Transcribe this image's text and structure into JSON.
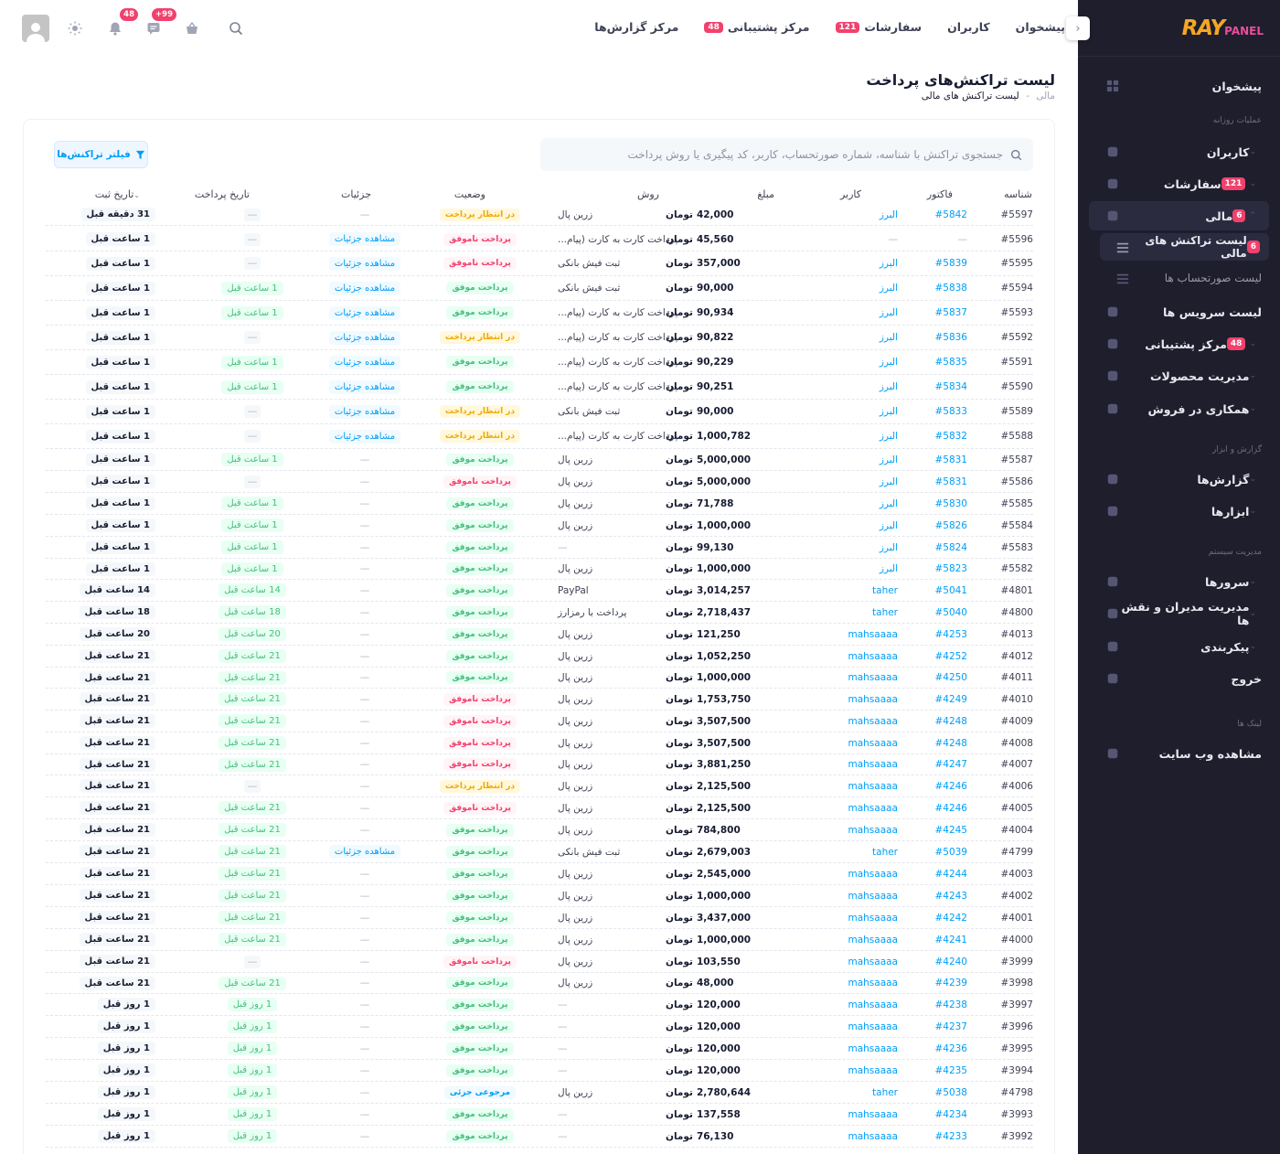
{
  "sidebar": {
    "brand_main": "RAY",
    "brand_sub": "PANEL",
    "items": [
      {
        "label": "پیشخوان",
        "icon": "dashboard-icon"
      },
      {
        "label": "کاربران",
        "icon": "users-icon"
      },
      {
        "label": "سفارشات",
        "icon": "cart-icon",
        "badge": "121"
      },
      {
        "label": "مالی",
        "icon": "wallet-icon",
        "badge": "6"
      },
      {
        "label": "لیست سرویس ها",
        "icon": "grid-icon"
      },
      {
        "label": "مرکز پشتیبانی",
        "icon": "support-icon",
        "badge": "48"
      },
      {
        "label": "مدیریت محصولات",
        "icon": "lock-icon"
      },
      {
        "label": "همکاری در فروش",
        "icon": "affiliate-icon"
      },
      {
        "label": "گزارش‌ها",
        "icon": "report-icon"
      },
      {
        "label": "ابزارها",
        "icon": "tools-icon"
      },
      {
        "label": "سرورها",
        "icon": "server-icon"
      },
      {
        "label": "مدیریت مدیران و نقش ها",
        "icon": "admins-icon"
      },
      {
        "label": "پیکربندی",
        "icon": "config-icon"
      },
      {
        "label": "خروج",
        "icon": "logout-icon"
      },
      {
        "label": "مشاهده وب سایت",
        "icon": "external-link-icon"
      }
    ],
    "sub_items": [
      {
        "label": "لیست تراکنش های مالی",
        "badge": "6"
      },
      {
        "label": "لیست صورتحساب ها"
      }
    ],
    "sections": [
      "عملیات روزانه",
      "گزارش و ابزار",
      "مدیریت سیستم",
      "لینک ها"
    ]
  },
  "header": {
    "nav": [
      {
        "label": "پیشخوان"
      },
      {
        "label": "کاربران"
      },
      {
        "label": "سفارشات",
        "badge": "121"
      },
      {
        "label": "مرکز پشتیبانی",
        "badge": "48"
      },
      {
        "label": "مرکز گزارش‌ها"
      }
    ],
    "cart_badge": "+99",
    "messages_badge": "48"
  },
  "page": {
    "title": "لیست تراکنش‌های پرداخت",
    "breadcrumb_parent": "مالی",
    "breadcrumb_sep": "-",
    "breadcrumb_current": "لیست تراکنش های مالی",
    "search_placeholder": "جستجوی تراکنش با شناسه، شماره صورتحساب، کاربر، کد پیگیری یا روش پرداخت",
    "filter_label": "فیلتر تراکنش‌ها"
  },
  "table": {
    "headers": {
      "id": "شناسه",
      "invoice": "فاکتور",
      "user": "کاربر",
      "amount": "مبلغ",
      "method": "روش",
      "status": "وضعیت",
      "details": "جزئیات",
      "pay_date": "تاریخ پرداخت",
      "reg_date": "تاریخ ثبت"
    },
    "currency": "تومان",
    "status_labels": {
      "pending": "در انتظار پرداخت",
      "failed": "پرداخت ناموفق",
      "success": "پرداخت موفق",
      "partial": "مرجوعی جزئی"
    },
    "details_label": "مشاهده جزئیات",
    "empty": "—",
    "rows": [
      {
        "id": "#5597",
        "inv": "#5842",
        "user": "البرز",
        "amt": "42,000",
        "meth": "زرین پال",
        "st": "pending",
        "det": false,
        "pd": "",
        "rd": "31 دقیقه قبل"
      },
      {
        "id": "#5596",
        "inv": "",
        "user": "",
        "amt": "45,560",
        "meth": "پرداخت کارت به کارت (پیام...",
        "st": "failed",
        "det": true,
        "pd": "",
        "rd": "1 ساعت قبل"
      },
      {
        "id": "#5595",
        "inv": "#5839",
        "user": "البرز",
        "amt": "357,000",
        "meth": "ثبت فیش بانکی",
        "st": "failed",
        "det": true,
        "pd": "",
        "rd": "1 ساعت قبل"
      },
      {
        "id": "#5594",
        "inv": "#5838",
        "user": "البرز",
        "amt": "90,000",
        "meth": "ثبت فیش بانکی",
        "st": "success",
        "det": true,
        "pd": "1 ساعت قبل",
        "rd": "1 ساعت قبل"
      },
      {
        "id": "#5593",
        "inv": "#5837",
        "user": "البرز",
        "amt": "90,934",
        "meth": "پرداخت کارت به کارت (پیام...",
        "st": "success",
        "det": true,
        "pd": "1 ساعت قبل",
        "rd": "1 ساعت قبل"
      },
      {
        "id": "#5592",
        "inv": "#5836",
        "user": "البرز",
        "amt": "90,822",
        "meth": "پرداخت کارت به کارت (پیام...",
        "st": "pending",
        "det": true,
        "pd": "",
        "rd": "1 ساعت قبل"
      },
      {
        "id": "#5591",
        "inv": "#5835",
        "user": "البرز",
        "amt": "90,229",
        "meth": "پرداخت کارت به کارت (پیام...",
        "st": "success",
        "det": true,
        "pd": "1 ساعت قبل",
        "rd": "1 ساعت قبل"
      },
      {
        "id": "#5590",
        "inv": "#5834",
        "user": "البرز",
        "amt": "90,251",
        "meth": "پرداخت کارت به کارت (پیام...",
        "st": "success",
        "det": true,
        "pd": "1 ساعت قبل",
        "rd": "1 ساعت قبل"
      },
      {
        "id": "#5589",
        "inv": "#5833",
        "user": "البرز",
        "amt": "90,000",
        "meth": "ثبت فیش بانکی",
        "st": "pending",
        "det": true,
        "pd": "",
        "rd": "1 ساعت قبل"
      },
      {
        "id": "#5588",
        "inv": "#5832",
        "user": "البرز",
        "amt": "1,000,782",
        "meth": "پرداخت کارت به کارت (پیام...",
        "st": "pending",
        "det": true,
        "pd": "",
        "rd": "1 ساعت قبل"
      },
      {
        "id": "#5587",
        "inv": "#5831",
        "user": "البرز",
        "amt": "5,000,000",
        "meth": "زرین پال",
        "st": "success",
        "det": false,
        "pd": "1 ساعت قبل",
        "rd": "1 ساعت قبل"
      },
      {
        "id": "#5586",
        "inv": "#5831",
        "user": "البرز",
        "amt": "5,000,000",
        "meth": "زرین پال",
        "st": "failed",
        "det": false,
        "pd": "",
        "rd": "1 ساعت قبل"
      },
      {
        "id": "#5585",
        "inv": "#5830",
        "user": "البرز",
        "amt": "71,788",
        "meth": "زرین پال",
        "st": "success",
        "det": false,
        "pd": "1 ساعت قبل",
        "rd": "1 ساعت قبل"
      },
      {
        "id": "#5584",
        "inv": "#5826",
        "user": "البرز",
        "amt": "1,000,000",
        "meth": "زرین پال",
        "st": "success",
        "det": false,
        "pd": "1 ساعت قبل",
        "rd": "1 ساعت قبل"
      },
      {
        "id": "#5583",
        "inv": "#5824",
        "user": "البرز",
        "amt": "99,130",
        "meth": "",
        "st": "success",
        "det": false,
        "pd": "1 ساعت قبل",
        "rd": "1 ساعت قبل"
      },
      {
        "id": "#5582",
        "inv": "#5823",
        "user": "البرز",
        "amt": "1,000,000",
        "meth": "زرین پال",
        "st": "success",
        "det": false,
        "pd": "1 ساعت قبل",
        "rd": "1 ساعت قبل"
      },
      {
        "id": "#4801",
        "inv": "#5041",
        "user": "taher",
        "amt": "3,014,257",
        "meth": "PayPal",
        "st": "success",
        "det": false,
        "pd": "14 ساعت قبل",
        "rd": "14 ساعت قبل"
      },
      {
        "id": "#4800",
        "inv": "#5040",
        "user": "taher",
        "amt": "2,718,437",
        "meth": "پرداخت با رمزارز",
        "st": "success",
        "det": false,
        "pd": "18 ساعت قبل",
        "rd": "18 ساعت قبل"
      },
      {
        "id": "#4013",
        "inv": "#4253",
        "user": "mahsaaaa",
        "amt": "121,250",
        "meth": "زرین پال",
        "st": "success",
        "det": false,
        "pd": "20 ساعت قبل",
        "rd": "20 ساعت قبل"
      },
      {
        "id": "#4012",
        "inv": "#4252",
        "user": "mahsaaaa",
        "amt": "1,052,250",
        "meth": "زرین پال",
        "st": "success",
        "det": false,
        "pd": "21 ساعت قبل",
        "rd": "21 ساعت قبل"
      },
      {
        "id": "#4011",
        "inv": "#4250",
        "user": "mahsaaaa",
        "amt": "1,000,000",
        "meth": "زرین پال",
        "st": "success",
        "det": false,
        "pd": "21 ساعت قبل",
        "rd": "21 ساعت قبل"
      },
      {
        "id": "#4010",
        "inv": "#4249",
        "user": "mahsaaaa",
        "amt": "1,753,750",
        "meth": "زرین پال",
        "st": "failed",
        "det": false,
        "pd": "21 ساعت قبل",
        "rd": "21 ساعت قبل"
      },
      {
        "id": "#4009",
        "inv": "#4248",
        "user": "mahsaaaa",
        "amt": "3,507,500",
        "meth": "زرین پال",
        "st": "failed",
        "det": false,
        "pd": "21 ساعت قبل",
        "rd": "21 ساعت قبل"
      },
      {
        "id": "#4008",
        "inv": "#4248",
        "user": "mahsaaaa",
        "amt": "3,507,500",
        "meth": "زرین پال",
        "st": "failed",
        "det": false,
        "pd": "21 ساعت قبل",
        "rd": "21 ساعت قبل"
      },
      {
        "id": "#4007",
        "inv": "#4247",
        "user": "mahsaaaa",
        "amt": "3,881,250",
        "meth": "زرین پال",
        "st": "failed",
        "det": false,
        "pd": "21 ساعت قبل",
        "rd": "21 ساعت قبل"
      },
      {
        "id": "#4006",
        "inv": "#4246",
        "user": "mahsaaaa",
        "amt": "2,125,500",
        "meth": "زرین پال",
        "st": "pending",
        "det": false,
        "pd": "",
        "rd": "21 ساعت قبل"
      },
      {
        "id": "#4005",
        "inv": "#4246",
        "user": "mahsaaaa",
        "amt": "2,125,500",
        "meth": "زرین پال",
        "st": "failed",
        "det": false,
        "pd": "21 ساعت قبل",
        "rd": "21 ساعت قبل"
      },
      {
        "id": "#4004",
        "inv": "#4245",
        "user": "mahsaaaa",
        "amt": "784,800",
        "meth": "زرین پال",
        "st": "success",
        "det": false,
        "pd": "21 ساعت قبل",
        "rd": "21 ساعت قبل"
      },
      {
        "id": "#4799",
        "inv": "#5039",
        "user": "taher",
        "amt": "2,679,003",
        "meth": "ثبت فیش بانکی",
        "st": "success",
        "det": true,
        "pd": "21 ساعت قبل",
        "rd": "21 ساعت قبل"
      },
      {
        "id": "#4003",
        "inv": "#4244",
        "user": "mahsaaaa",
        "amt": "2,545,000",
        "meth": "زرین پال",
        "st": "success",
        "det": false,
        "pd": "21 ساعت قبل",
        "rd": "21 ساعت قبل"
      },
      {
        "id": "#4002",
        "inv": "#4243",
        "user": "mahsaaaa",
        "amt": "1,000,000",
        "meth": "زرین پال",
        "st": "success",
        "det": false,
        "pd": "21 ساعت قبل",
        "rd": "21 ساعت قبل"
      },
      {
        "id": "#4001",
        "inv": "#4242",
        "user": "mahsaaaa",
        "amt": "3,437,000",
        "meth": "زرین پال",
        "st": "success",
        "det": false,
        "pd": "21 ساعت قبل",
        "rd": "21 ساعت قبل"
      },
      {
        "id": "#4000",
        "inv": "#4241",
        "user": "mahsaaaa",
        "amt": "1,000,000",
        "meth": "زرین پال",
        "st": "success",
        "det": false,
        "pd": "21 ساعت قبل",
        "rd": "21 ساعت قبل"
      },
      {
        "id": "#3999",
        "inv": "#4240",
        "user": "mahsaaaa",
        "amt": "103,550",
        "meth": "زرین پال",
        "st": "failed",
        "det": false,
        "pd": "",
        "rd": "21 ساعت قبل"
      },
      {
        "id": "#3998",
        "inv": "#4239",
        "user": "mahsaaaa",
        "amt": "48,000",
        "meth": "زرین پال",
        "st": "success",
        "det": false,
        "pd": "21 ساعت قبل",
        "rd": "21 ساعت قبل"
      },
      {
        "id": "#3997",
        "inv": "#4238",
        "user": "mahsaaaa",
        "amt": "120,000",
        "meth": "",
        "st": "success",
        "det": false,
        "pd": "1 روز قبل",
        "rd": "1 روز قبل"
      },
      {
        "id": "#3996",
        "inv": "#4237",
        "user": "mahsaaaa",
        "amt": "120,000",
        "meth": "",
        "st": "success",
        "det": false,
        "pd": "1 روز قبل",
        "rd": "1 روز قبل"
      },
      {
        "id": "#3995",
        "inv": "#4236",
        "user": "mahsaaaa",
        "amt": "120,000",
        "meth": "",
        "st": "success",
        "det": false,
        "pd": "1 روز قبل",
        "rd": "1 روز قبل"
      },
      {
        "id": "#3994",
        "inv": "#4235",
        "user": "mahsaaaa",
        "amt": "120,000",
        "meth": "",
        "st": "success",
        "det": false,
        "pd": "1 روز قبل",
        "rd": "1 روز قبل"
      },
      {
        "id": "#4798",
        "inv": "#5038",
        "user": "taher",
        "amt": "2,780,644",
        "meth": "زرین پال",
        "st": "partial",
        "det": false,
        "pd": "1 روز قبل",
        "rd": "1 روز قبل"
      },
      {
        "id": "#3993",
        "inv": "#4234",
        "user": "mahsaaaa",
        "amt": "137,558",
        "meth": "",
        "st": "success",
        "det": false,
        "pd": "1 روز قبل",
        "rd": "1 روز قبل"
      },
      {
        "id": "#3992",
        "inv": "#4233",
        "user": "mahsaaaa",
        "amt": "76,130",
        "meth": "",
        "st": "success",
        "det": false,
        "pd": "1 روز قبل",
        "rd": "1 روز قبل"
      }
    ]
  }
}
